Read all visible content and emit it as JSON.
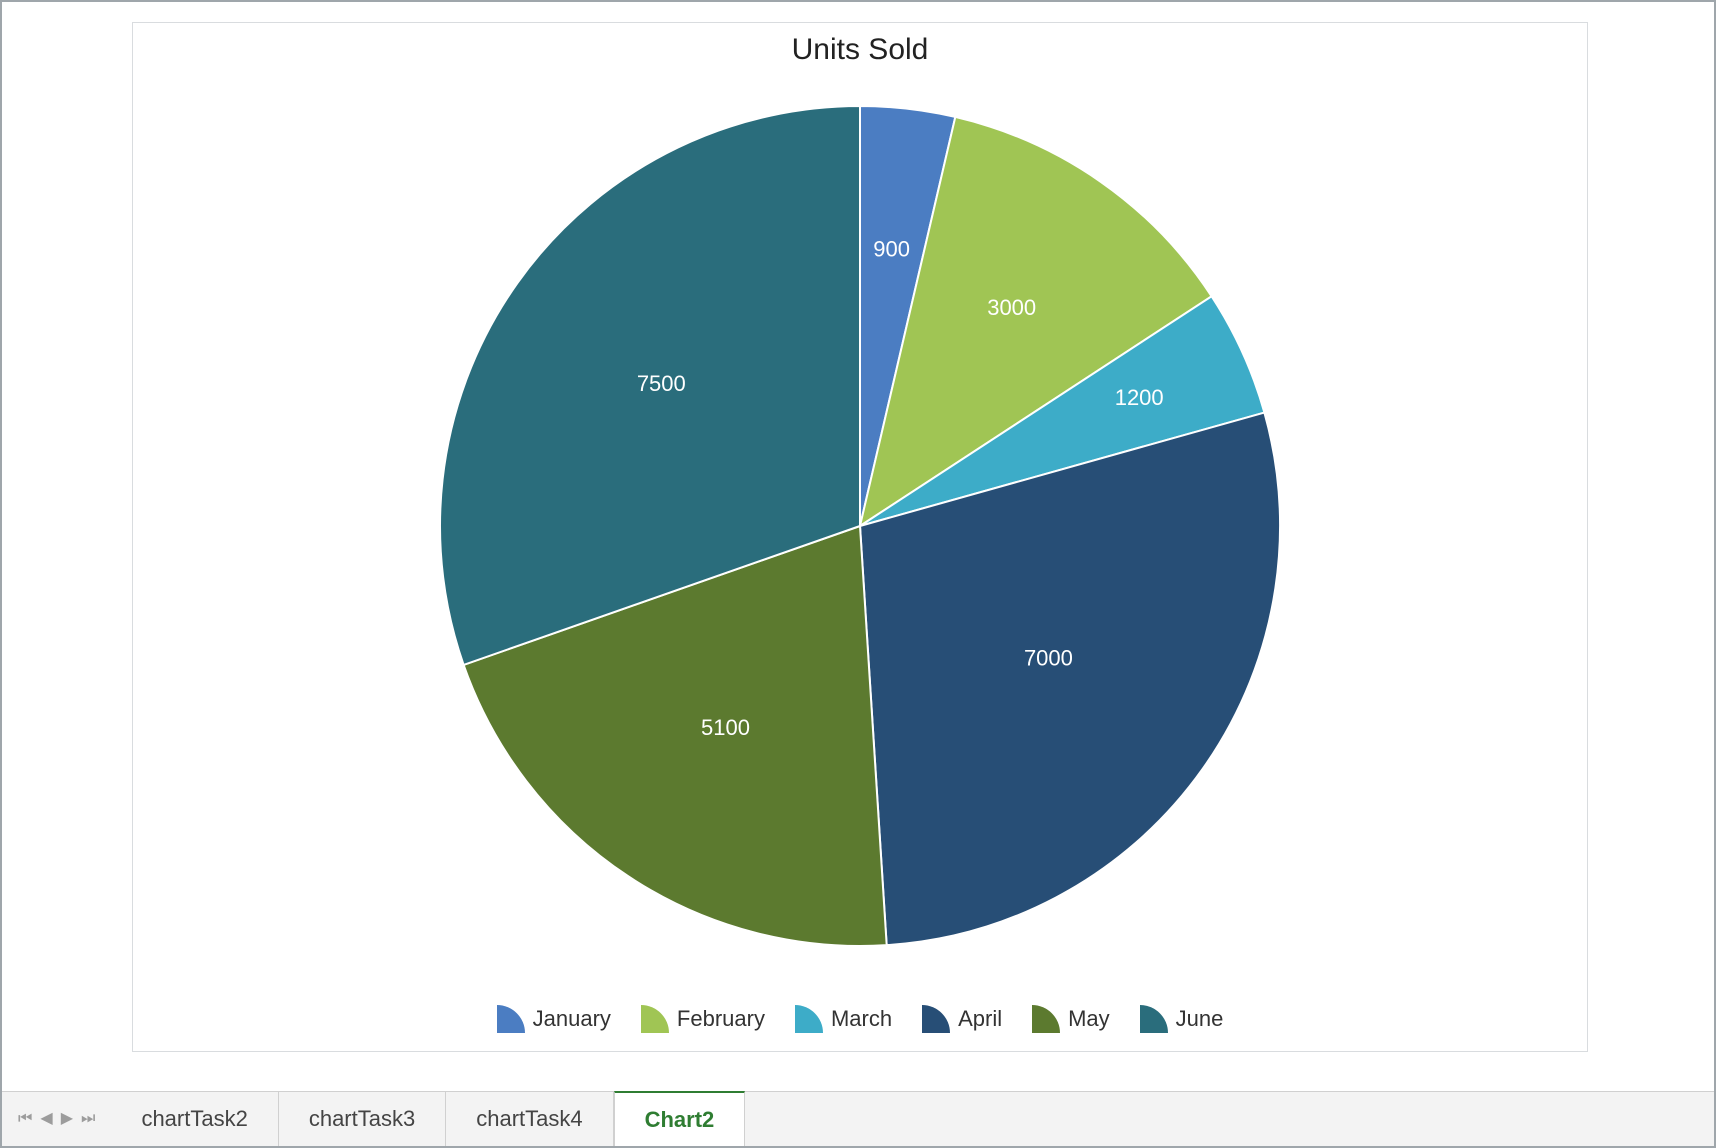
{
  "chart_data": {
    "type": "pie",
    "title": "Units Sold",
    "series": [
      {
        "name": "January",
        "value": 900,
        "color": "#4b7dc2"
      },
      {
        "name": "February",
        "value": 3000,
        "color": "#a0c554"
      },
      {
        "name": "March",
        "value": 1200,
        "color": "#3dacc8"
      },
      {
        "name": "April",
        "value": 7000,
        "color": "#274e76"
      },
      {
        "name": "May",
        "value": 5100,
        "color": "#5c7a2f"
      },
      {
        "name": "June",
        "value": 7500,
        "color": "#2a6d7c"
      }
    ]
  },
  "tabs": {
    "items": [
      {
        "label": "chartTask2",
        "active": false
      },
      {
        "label": "chartTask3",
        "active": false
      },
      {
        "label": "chartTask4",
        "active": false
      },
      {
        "label": "Chart2",
        "active": true
      }
    ],
    "nav": {
      "first": "⏮",
      "prev": "◀",
      "next": "▶",
      "last": "⏭"
    }
  }
}
